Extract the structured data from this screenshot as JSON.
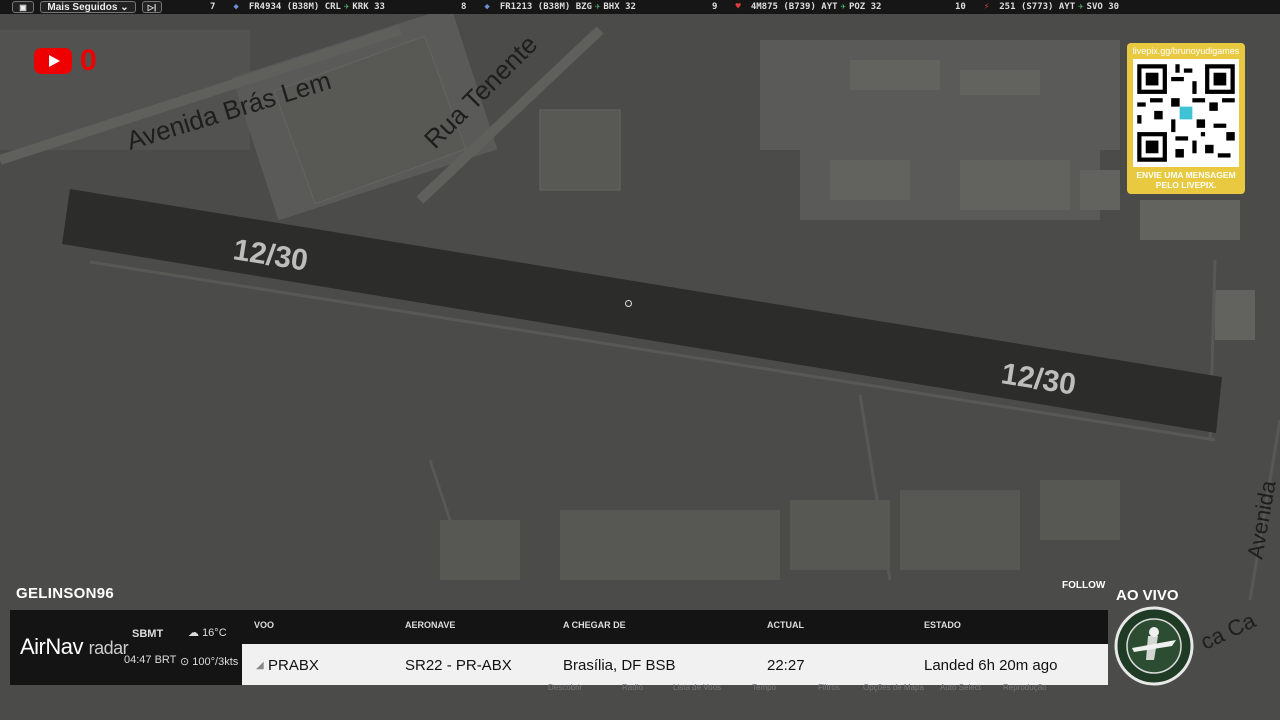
{
  "topbar": {
    "filter_label": "Mais Seguidos ⌄",
    "tickers": [
      {
        "rank": "7",
        "text": "FR4934 (B38M) CRL",
        "dest": "KRK 33",
        "color": "#6b8fd6"
      },
      {
        "rank": "8",
        "text": "FR1213 (B38M) BZG",
        "dest": "BHX 32",
        "color": "#6b8fd6"
      },
      {
        "rank": "9",
        "text": "4M875 (B739) AYT",
        "dest": "POZ 32",
        "color": "#e03c3c"
      },
      {
        "rank": "10",
        "text": "251 (S773) AYT",
        "dest": "SVO 30",
        "color": "#e03c3c"
      }
    ]
  },
  "youtube": {
    "count": "0"
  },
  "qr": {
    "url": "livepix.gg/brunoyudigames",
    "message": "ENVIE UMA MENSAGEM PELO LIVEPIX."
  },
  "map": {
    "runway_label_left": "12/30",
    "runway_label_right": "12/30",
    "street_1": "Avenida Brás Lem",
    "street_2": "Rua Tenente",
    "street_3": "Avenida",
    "street_4": "ca Ca"
  },
  "stream": {
    "username": "GELINSON96",
    "follow": "FOLLOW",
    "live": "AO VIVO"
  },
  "panel": {
    "brand_main": "AirNav",
    "brand_sub": "radar",
    "airport": "SBMT",
    "time": "04:47 BRT",
    "temp": "16°C",
    "wind": "100°/3kts",
    "headers": {
      "flight": "VOO",
      "aircraft": "AERONAVE",
      "from": "A CHEGAR DE",
      "actual": "ACTUAL",
      "status": "ESTADO"
    },
    "row": {
      "flight": "PRABX",
      "aircraft": "SR22 - PR-ABX",
      "from": "Brasília, DF BSB",
      "actual": "22:27",
      "status": "Landed 6h 20m ago"
    }
  },
  "faint_menu": [
    "Descobrir",
    "Radio",
    "Lista de Voos",
    "Tempo",
    "Filtros",
    "Opções de Mapa",
    "Auto Select",
    "Reprodução"
  ]
}
